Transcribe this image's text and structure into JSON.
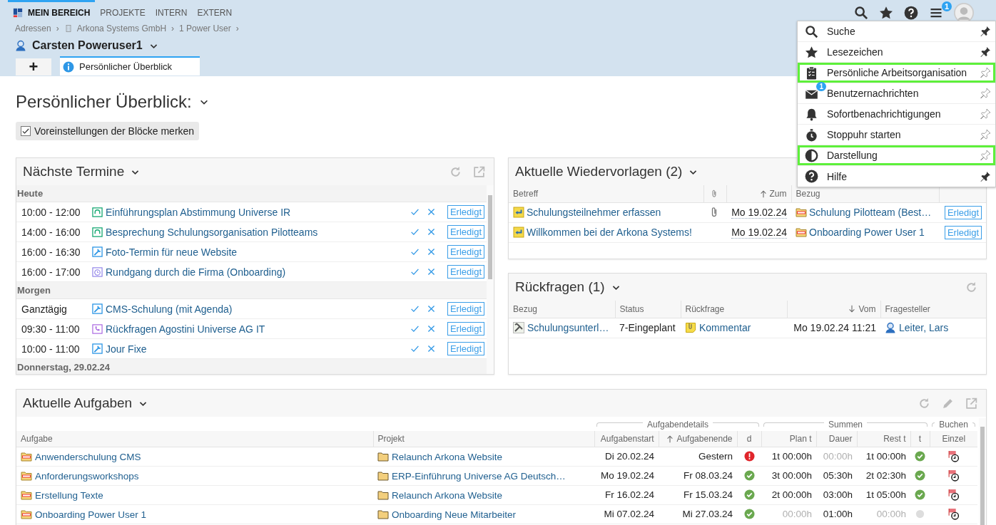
{
  "nav": {
    "tabs": [
      {
        "label": "MEIN BEREICH",
        "selected": true
      },
      {
        "label": "PROJEKTE",
        "selected": false
      },
      {
        "label": "INTERN",
        "selected": false
      },
      {
        "label": "EXTERN",
        "selected": false
      }
    ],
    "menu_badge": "1"
  },
  "breadcrumb": {
    "separator": "›",
    "items": [
      {
        "label": "Adressen",
        "kind": "plain"
      },
      {
        "label": "Arkona Systems GmbH",
        "kind": "company"
      },
      {
        "label": "1 Power User",
        "kind": "plain"
      }
    ]
  },
  "person": "Carsten Poweruser1",
  "page_tabs": {
    "add": "+",
    "tabs": [
      {
        "label": "Persönlicher Überblick",
        "selected": true
      }
    ]
  },
  "heading": "Persönlicher Überblick:",
  "remember": {
    "label": "Voreinstellungen der Blöcke merken",
    "checked": true
  },
  "termine": {
    "title": "Nächste Termine",
    "groups": [
      {
        "label": "Heute",
        "rows": [
          {
            "time": "10:00 - 12:00",
            "title": "Einführungsplan Abstimmung Universe IR",
            "kind": "meeting",
            "action": "Erledigt"
          },
          {
            "time": "14:00 - 16:00",
            "title": "Besprechung Schulungsorganisation Pilotteams",
            "kind": "meeting",
            "action": "Erledigt"
          },
          {
            "time": "16:00 - 16:30",
            "title": "Foto-Termin für neue Website",
            "kind": "task",
            "action": "Erledigt"
          },
          {
            "time": "16:00 - 17:00",
            "title": "Rundgang durch die Firma (Onboarding)",
            "kind": "event",
            "action": "Erledigt"
          }
        ]
      },
      {
        "label": "Morgen",
        "rows": [
          {
            "time": "Ganztägig",
            "title": "CMS-Schulung (mit Agenda)",
            "kind": "task",
            "action": "Erledigt"
          },
          {
            "time": "09:30 - 11:00",
            "title": "Rückfragen Agostini Universe AG IT",
            "kind": "call",
            "action": "Erledigt"
          },
          {
            "time": "10:00 - 11:00",
            "title": "Jour Fixe",
            "kind": "task",
            "action": "Erledigt"
          }
        ]
      },
      {
        "label": "Donnerstag, 29.02.24"
      }
    ]
  },
  "wiedervorlagen": {
    "title": "Aktuelle Wiedervorlagen (2)",
    "columns": [
      {
        "kind": "text",
        "label": "Betreff"
      },
      {
        "kind": "attachment"
      },
      {
        "kind": "ascending",
        "label": "Zum"
      },
      {
        "kind": "text",
        "label": "Bezug"
      },
      {
        "kind": "blank"
      }
    ],
    "rows": [
      {
        "betreff": "Schulungsteilnehmer erfassen",
        "attachment": true,
        "date": "Mo 19.02.24",
        "bezug": "Schulung Pilotteam (Best…",
        "action": "Erledigt"
      },
      {
        "betreff": "Willkommen bei der Arkona Systems!",
        "attachment": false,
        "date": "Mo 19.02.24",
        "bezug": "Onboarding Power User 1",
        "action": "Erledigt"
      }
    ]
  },
  "rueckfragen": {
    "title": "Rückfragen (1)",
    "columns": [
      {
        "kind": "text",
        "label": "Bezug"
      },
      {
        "kind": "text",
        "label": "Status"
      },
      {
        "kind": "text",
        "label": "Rückfrage"
      },
      {
        "kind": "descending",
        "label": "Vom"
      },
      {
        "kind": "text",
        "label": "Fragesteller"
      }
    ],
    "rows": [
      {
        "bezug": "Schulungsunterl…",
        "status": "7-Eingeplant",
        "rueckfrage": "Kommentar",
        "vom": "Mo 19.02.24 11:21",
        "fragesteller": "Leiter, Lars"
      }
    ]
  },
  "aufgaben": {
    "title": "Aktuelle Aufgaben",
    "groups": [
      {
        "label": "Aufgabendetails"
      },
      {
        "label": "Summen"
      },
      {
        "label": "Buchen"
      }
    ],
    "columns": [
      {
        "kind": "text",
        "label": "Aufgabe"
      },
      {
        "kind": "text",
        "label": "Projekt"
      },
      {
        "kind": "text",
        "label": "Aufgabenstart"
      },
      {
        "kind": "ascending",
        "label": "Aufgabenende"
      },
      {
        "kind": "text",
        "label": "d"
      },
      {
        "kind": "text",
        "label": "Plan t"
      },
      {
        "kind": "text",
        "label": "Dauer"
      },
      {
        "kind": "text",
        "label": "Rest t"
      },
      {
        "kind": "text",
        "label": "t"
      },
      {
        "kind": "text",
        "label": "Einzel"
      }
    ],
    "rows": [
      {
        "aufgabe": "Anwenderschulung CMS",
        "projekt": "Relaunch Arkona Website",
        "start": "Di 20.02.24",
        "end": "Gestern",
        "overdue": true,
        "plan": {
          "text": "1t 00:00h",
          "muted": false
        },
        "dauer": {
          "text": "00:00h",
          "muted": true
        },
        "rest": {
          "text": "1t 00:00h",
          "muted": false
        },
        "time_ok": true
      },
      {
        "aufgabe": "Anforderungsworkshops",
        "projekt": "ERP-Einführung Universe AG Deutsch…",
        "start": "Mo 19.02.24",
        "end": "Fr 08.03.24",
        "overdue": false,
        "plan": {
          "text": "3t 00:00h",
          "muted": false
        },
        "dauer": {
          "text": "05:30h",
          "muted": false
        },
        "rest": {
          "text": "2t 02:30h",
          "muted": false
        },
        "time_ok": true
      },
      {
        "aufgabe": "Erstellung Texte",
        "projekt": "Relaunch Arkona Website",
        "start": "Fr 16.02.24",
        "end": "Fr 15.03.24",
        "overdue": false,
        "plan": {
          "text": "2t 00:00h",
          "muted": false
        },
        "dauer": {
          "text": "03:00h",
          "muted": false
        },
        "rest": {
          "text": "1t 05:00h",
          "muted": false
        },
        "time_ok": true
      },
      {
        "aufgabe": "Onboarding Power User 1",
        "projekt": "Onboarding Neue Mitarbeiter",
        "start": "Mi 07.02.24",
        "end": "Mi 27.03.24",
        "overdue": false,
        "plan": {
          "text": "00:00h",
          "muted": true
        },
        "dauer": {
          "text": "01:00h",
          "muted": false
        },
        "rest": {
          "text": "00:00h",
          "muted": true
        },
        "time_ok": false
      }
    ]
  },
  "menu": {
    "items": [
      {
        "label": "Suche",
        "kind": "search",
        "pinned": true,
        "highlighted": false
      },
      {
        "label": "Lesezeichen",
        "kind": "bookmarks",
        "pinned": true,
        "highlighted": false
      },
      {
        "label": "Persönliche Arbeitsorganisation",
        "kind": "organizer",
        "pinned": false,
        "highlighted": true
      },
      {
        "label": "Benutzernachrichten",
        "kind": "messages",
        "badge": "1",
        "pinned": false,
        "highlighted": false
      },
      {
        "label": "Sofortbenachrichtigungen",
        "kind": "notifications",
        "pinned": false,
        "highlighted": false
      },
      {
        "label": "Stoppuhr starten",
        "kind": "stopwatch",
        "pinned": false,
        "highlighted": false
      },
      {
        "label": "Darstellung",
        "kind": "appearance",
        "pinned": false,
        "highlighted": true
      },
      {
        "label": "Hilfe",
        "kind": "help",
        "pinned": true,
        "highlighted": false
      }
    ]
  }
}
